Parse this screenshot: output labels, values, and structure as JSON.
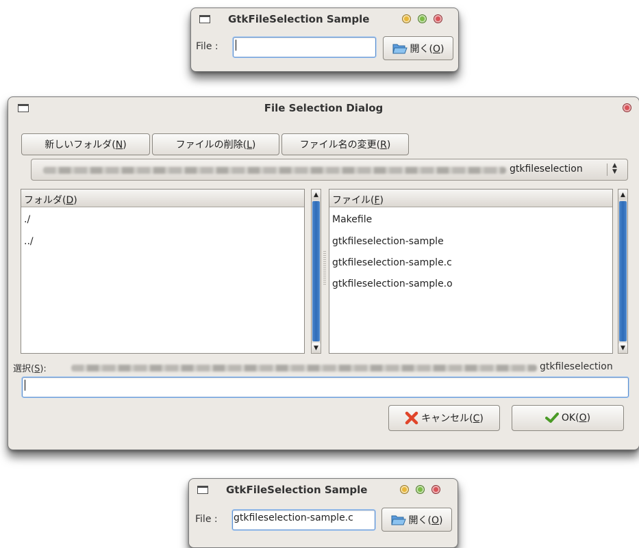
{
  "top_window": {
    "title": "GtkFileSelection Sample",
    "file_label": "File :",
    "file_value": "",
    "open_button_prefix": "開く(",
    "open_button_mnemonic": "O",
    "open_button_suffix": ")"
  },
  "dialog": {
    "title": "File Selection Dialog",
    "buttons": [
      {
        "prefix": "新しいフォルダ(",
        "mnemonic": "N",
        "suffix": ")"
      },
      {
        "prefix": "ファイルの削除(",
        "mnemonic": "L",
        "suffix": ")"
      },
      {
        "prefix": "ファイル名の変更(",
        "mnemonic": "R",
        "suffix": ")"
      }
    ],
    "path_combo_value": "gtkfileselection",
    "folders_header_prefix": "フォルダ(",
    "folders_header_mnemonic": "D",
    "folders_header_suffix": ")",
    "folders": [
      "./",
      "../"
    ],
    "files_header_prefix": "ファイル(",
    "files_header_mnemonic": "F",
    "files_header_suffix": ")",
    "files": [
      "Makefile",
      "gtkfileselection-sample",
      "gtkfileselection-sample.c",
      "gtkfileselection-sample.o"
    ],
    "selection_label_prefix": "選択(",
    "selection_label_mnemonic": "S",
    "selection_label_suffix": "):",
    "selection_path_tail": "gtkfileselection",
    "selection_entry_value": "",
    "cancel_prefix": "キャンセル(",
    "cancel_mnemonic": "C",
    "cancel_suffix": ")",
    "ok_prefix": "OK(",
    "ok_mnemonic": "O",
    "ok_suffix": ")"
  },
  "bottom_window": {
    "title": "GtkFileSelection Sample",
    "file_label": "File :",
    "file_value": "gtkfileselection-sample.c",
    "open_button_prefix": "開く(",
    "open_button_mnemonic": "O",
    "open_button_suffix": ")"
  },
  "colors": {
    "window_bg": "#ece9e4",
    "scroll_thumb": "#2f6cb8",
    "cancel_icon": "#e0452a",
    "ok_icon": "#4a9a26"
  }
}
